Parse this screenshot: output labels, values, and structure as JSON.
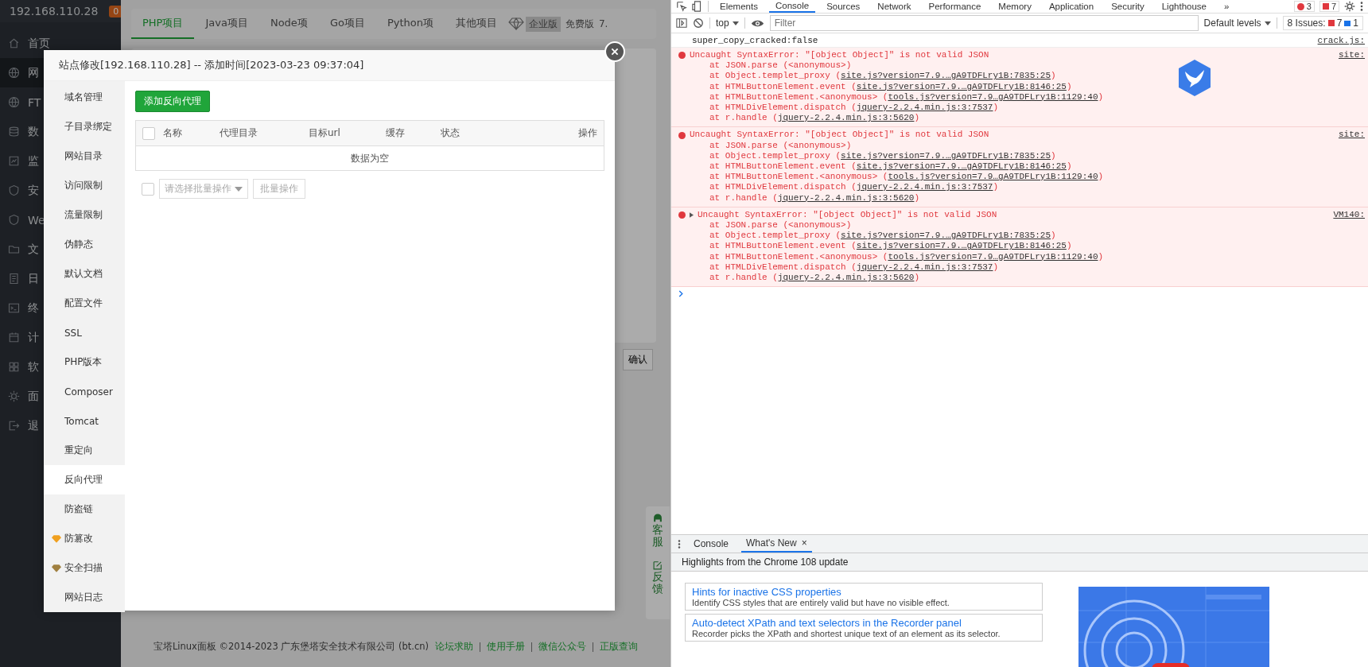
{
  "bt_sidebar": {
    "host": "192.168.110.28",
    "badge": "0",
    "items": [
      {
        "label": "首页",
        "selected": false
      },
      {
        "label": "网",
        "selected": true
      },
      {
        "label": "FT",
        "selected": false
      },
      {
        "label": "数",
        "selected": false
      },
      {
        "label": "监",
        "selected": false
      },
      {
        "label": "安",
        "selected": false
      },
      {
        "label": "We",
        "selected": false
      },
      {
        "label": "文",
        "selected": false
      },
      {
        "label": "日",
        "selected": false
      },
      {
        "label": "终",
        "selected": false
      },
      {
        "label": "计",
        "selected": false
      },
      {
        "label": "软",
        "selected": false
      },
      {
        "label": "面",
        "selected": false
      },
      {
        "label": "退",
        "selected": false
      }
    ]
  },
  "project_tabs": [
    {
      "label": "PHP项目",
      "selected": true
    },
    {
      "label": "Java项目",
      "selected": false
    },
    {
      "label": "Node项",
      "selected": false
    },
    {
      "label": "Go项目",
      "selected": false
    },
    {
      "label": "Python项",
      "selected": false
    },
    {
      "label": "其他项目",
      "selected": false
    }
  ],
  "edition": {
    "enterprise": "企业版",
    "free": "免费版",
    "version": "7."
  },
  "behind": {
    "confirm": "确认"
  },
  "float_widget": [
    {
      "label": "客服"
    },
    {
      "label": "反馈"
    }
  ],
  "footer": {
    "copyright": "宝塔Linux面板 ©2014-2023 广东堡塔安全技术有限公司 (bt.cn)",
    "links": [
      "论坛求助",
      "使用手册",
      "微信公众号",
      "正版查询"
    ]
  },
  "dialog": {
    "title": "站点修改[192.168.110.28] -- 添加时间[2023-03-23 09:37:04]",
    "menu": [
      {
        "label": "域名管理",
        "selected": false
      },
      {
        "label": "子目录绑定",
        "selected": false
      },
      {
        "label": "网站目录",
        "selected": false
      },
      {
        "label": "访问限制",
        "selected": false
      },
      {
        "label": "流量限制",
        "selected": false
      },
      {
        "label": "伪静态",
        "selected": false
      },
      {
        "label": "默认文档",
        "selected": false
      },
      {
        "label": "配置文件",
        "selected": false
      },
      {
        "label": "SSL",
        "selected": false
      },
      {
        "label": "PHP版本",
        "selected": false
      },
      {
        "label": "Composer",
        "selected": false
      },
      {
        "label": "Tomcat",
        "selected": false
      },
      {
        "label": "重定向",
        "selected": false
      },
      {
        "label": "反向代理",
        "selected": true
      },
      {
        "label": "防盗链",
        "selected": false
      },
      {
        "label": "防篡改",
        "selected": false,
        "color": "#f0a020"
      },
      {
        "label": "安全扫描",
        "selected": false,
        "color": "#a08040"
      },
      {
        "label": "网站日志",
        "selected": false
      }
    ],
    "add_button": "添加反向代理",
    "select_all": {
      "checked": false
    },
    "columns": [
      "名称",
      "代理目录",
      "目标url",
      "缓存",
      "状态",
      "操作"
    ],
    "empty": "数据为空",
    "batch_checkbox": {
      "checked": false
    },
    "batch_select": {
      "placeholder": "请选择批量操作"
    },
    "batch_button": {
      "label": "批量操作",
      "disabled": true
    }
  },
  "devtools": {
    "tabs": [
      {
        "label": "Elements",
        "selected": false
      },
      {
        "label": "Console",
        "selected": true
      },
      {
        "label": "Sources",
        "selected": false
      },
      {
        "label": "Network",
        "selected": false
      },
      {
        "label": "Performance",
        "selected": false
      },
      {
        "label": "Memory",
        "selected": false
      },
      {
        "label": "Application",
        "selected": false
      },
      {
        "label": "Security",
        "selected": false
      },
      {
        "label": "Lighthouse",
        "selected": false
      }
    ],
    "more": "»",
    "error_count": "3",
    "warning_count": "7",
    "context": "top",
    "filter": {
      "placeholder": "Filter"
    },
    "levels": "Default levels",
    "issues": {
      "label": "8 Issues:",
      "errors": "7",
      "infos": "1"
    },
    "messages": [
      {
        "kind": "log",
        "text": "super_copy_cracked:false",
        "source": "crack.js:"
      },
      {
        "kind": "error",
        "expandable": false,
        "text": "Uncaught SyntaxError: \"[object Object]\" is not valid JSON",
        "source": "site:",
        "stack": [
          {
            "prefix": "at JSON.parse (<anonymous>)"
          },
          {
            "prefix": "at Object.templet_proxy (",
            "link": "site.js?version=7.9.…gA9TDFLry1B:7835:25",
            "suffix": ")"
          },
          {
            "prefix": "at HTMLButtonElement.event (",
            "link": "site.js?version=7.9.…gA9TDFLry1B:8146:25",
            "suffix": ")"
          },
          {
            "prefix": "at HTMLButtonElement.<anonymous> (",
            "link": "tools.js?version=7.9…gA9TDFLry1B:1129:40",
            "suffix": ")"
          },
          {
            "prefix": "at HTMLDivElement.dispatch (",
            "link": "jquery-2.2.4.min.js:3:7537",
            "suffix": ")"
          },
          {
            "prefix": "at r.handle (",
            "link": "jquery-2.2.4.min.js:3:5620",
            "suffix": ")"
          }
        ]
      },
      {
        "kind": "error",
        "expandable": false,
        "text": "Uncaught SyntaxError: \"[object Object]\" is not valid JSON",
        "source": "site:",
        "stack": [
          {
            "prefix": "at JSON.parse (<anonymous>)"
          },
          {
            "prefix": "at Object.templet_proxy (",
            "link": "site.js?version=7.9.…gA9TDFLry1B:7835:25",
            "suffix": ")"
          },
          {
            "prefix": "at HTMLButtonElement.event (",
            "link": "site.js?version=7.9.…gA9TDFLry1B:8146:25",
            "suffix": ")"
          },
          {
            "prefix": "at HTMLButtonElement.<anonymous> (",
            "link": "tools.js?version=7.9…gA9TDFLry1B:1129:40",
            "suffix": ")"
          },
          {
            "prefix": "at HTMLDivElement.dispatch (",
            "link": "jquery-2.2.4.min.js:3:7537",
            "suffix": ")"
          },
          {
            "prefix": "at r.handle (",
            "link": "jquery-2.2.4.min.js:3:5620",
            "suffix": ")"
          }
        ]
      },
      {
        "kind": "error",
        "expandable": true,
        "text": "Uncaught SyntaxError: \"[object Object]\" is not valid JSON",
        "source": "VM140:",
        "stack": [
          {
            "prefix": "at JSON.parse (<anonymous>)"
          },
          {
            "prefix": "at Object.templet_proxy (",
            "link": "site.js?version=7.9.…gA9TDFLry1B:7835:25",
            "suffix": ")"
          },
          {
            "prefix": "at HTMLButtonElement.event (",
            "link": "site.js?version=7.9.…gA9TDFLry1B:8146:25",
            "suffix": ")"
          },
          {
            "prefix": "at HTMLButtonElement.<anonymous> (",
            "link": "tools.js?version=7.9…gA9TDFLry1B:1129:40",
            "suffix": ")"
          },
          {
            "prefix": "at HTMLDivElement.dispatch (",
            "link": "jquery-2.2.4.min.js:3:7537",
            "suffix": ")"
          },
          {
            "prefix": "at r.handle (",
            "link": "jquery-2.2.4.min.js:3:5620",
            "suffix": ")"
          }
        ]
      }
    ],
    "drawer": {
      "tabs": [
        {
          "label": "Console",
          "selected": false
        },
        {
          "label": "What's New",
          "selected": true,
          "close": "×"
        }
      ],
      "heading": "Highlights from the Chrome 108 update",
      "cards": [
        {
          "title": "Hints for inactive CSS properties",
          "text": "Identify CSS styles that are entirely valid but have no visible effect."
        },
        {
          "title": "Auto-detect XPath and text selectors in the Recorder panel",
          "text": "Recorder picks the XPath and shortest unique text of an element as its selector."
        }
      ]
    }
  }
}
